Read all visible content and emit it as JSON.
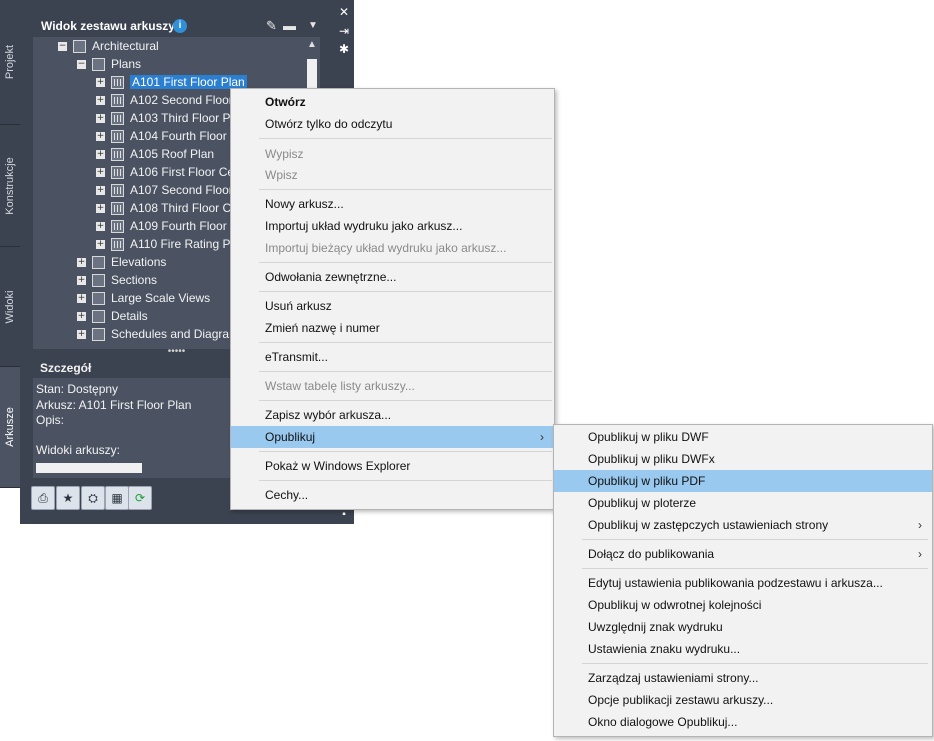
{
  "palette": {
    "title": "Widok zestawu arkuszy",
    "tabs": [
      "Projekt",
      "Konstrukcje",
      "Widoki",
      "Arkusze"
    ],
    "tree": {
      "root": "Architectural",
      "plans": "Plans",
      "sheets": [
        "A101 First Floor Plan",
        "A102 Second Floor",
        "A103 Third Floor P",
        "A104 Fourth Floor",
        "A105 Roof Plan",
        "A106 First Floor Ce",
        "A107 Second Floor",
        "A108 Third Floor C",
        "A109 Fourth Floor",
        "A110 Fire Rating Pl"
      ],
      "groups": [
        "Elevations",
        "Sections",
        "Large Scale Views",
        "Details",
        "Schedules and Diagrams"
      ]
    },
    "grip": "•••••",
    "detail": {
      "title": "Szczegół",
      "status": "Stan: Dostępny",
      "sheet": "Arkusz: A101 First Floor Plan",
      "description": "Opis:",
      "views": "Widoki arkuszy:"
    }
  },
  "menu": {
    "open": "Otwórz",
    "open_readonly": "Otwórz tylko do odczytu",
    "checkout": "Wypisz",
    "checkin": "Wpisz",
    "new_sheet": "Nowy arkusz...",
    "import_layout": "Importuj układ wydruku jako arkusz...",
    "import_current": "Importuj bieżący układ wydruku jako arkusz...",
    "xrefs": "Odwołania zewnętrzne...",
    "delete_sheet": "Usuń arkusz",
    "rename": "Zmień nazwę i numer",
    "etransmit": "eTransmit...",
    "insert_table": "Wstaw tabelę listy arkuszy...",
    "save_selection": "Zapisz wybór arkusza...",
    "publish": "Opublikuj",
    "explorer": "Pokaż w Windows Explorer",
    "properties": "Cechy..."
  },
  "submenu": {
    "dwf": "Opublikuj w pliku DWF",
    "dwfx": "Opublikuj w pliku DWFx",
    "pdf": "Opublikuj w pliku PDF",
    "plotter": "Opublikuj w ploterze",
    "override": "Opublikuj w zastępczych ustawieniach strony",
    "include": "Dołącz do publikowania",
    "edit_settings": "Edytuj ustawienia publikowania podzestawu i arkusza...",
    "reverse": "Opublikuj w odwrotnej kolejności",
    "stamp": "Uwzględnij znak wydruku",
    "stamp_settings": "Ustawienia znaku wydruku...",
    "page_setups": "Zarządzaj ustawieniami strony...",
    "options": "Opcje publikacji zestawu arkuszy...",
    "dialog": "Okno dialogowe Opublikuj..."
  }
}
